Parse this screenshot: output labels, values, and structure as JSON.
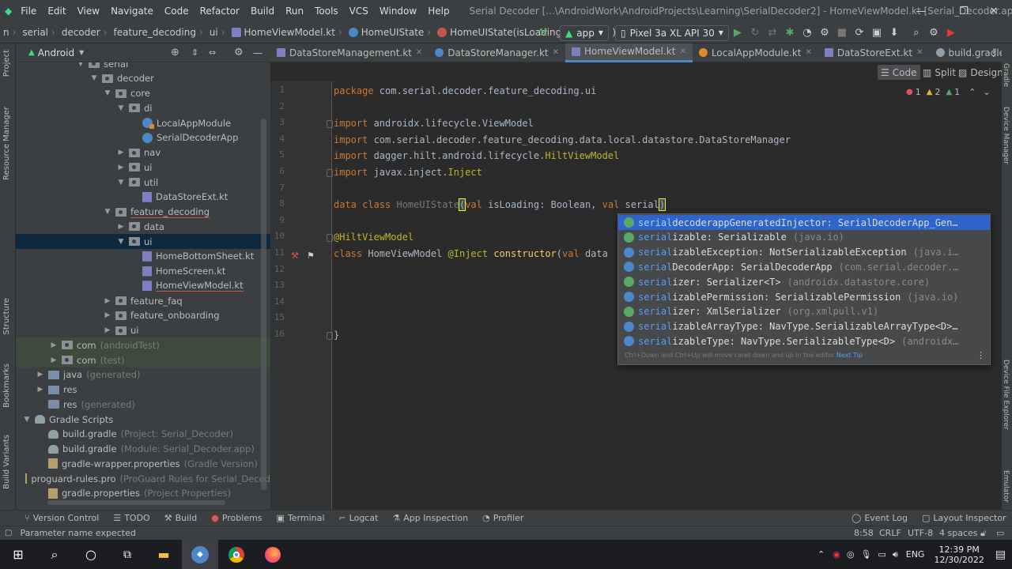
{
  "window": {
    "title": "Serial Decoder [...\\AndroidWork\\AndroidProjects\\Learning\\SerialDecoder2] - HomeViewModel.kt [Serial_Decoder.app.main]",
    "menu": [
      "File",
      "Edit",
      "View",
      "Navigate",
      "Code",
      "Refactor",
      "Build",
      "Run",
      "Tools",
      "VCS",
      "Window",
      "Help"
    ]
  },
  "navbar": {
    "crumbs": [
      "n",
      "serial",
      "decoder",
      "feature_decoding",
      "ui",
      "HomeViewModel.kt",
      "HomeUIState",
      "HomeUIState(isLoading: Boolean, )"
    ],
    "run_config": "app",
    "device": "Pixel 3a XL API 30"
  },
  "left_strip": {
    "tabs": [
      "Project",
      "Resource Manager",
      "Structure",
      "Bookmarks",
      "Build Variants"
    ]
  },
  "project_panel": {
    "view_mode": "Android",
    "tree": [
      {
        "label": "serial",
        "type": "pkg",
        "arrow": "v",
        "depth": 4
      },
      {
        "label": "decoder",
        "type": "pkg",
        "arrow": "v",
        "depth": 5
      },
      {
        "label": "core",
        "type": "pkg",
        "arrow": "v",
        "depth": 6
      },
      {
        "label": "di",
        "type": "pkg",
        "arrow": "v",
        "depth": 7
      },
      {
        "label": "LocalAppModule",
        "type": "ktg",
        "depth": 8
      },
      {
        "label": "SerialDecoderApp",
        "type": "kt",
        "depth": 8
      },
      {
        "label": "nav",
        "type": "pkg",
        "arrow": ">",
        "depth": 7
      },
      {
        "label": "ui",
        "type": "pkg",
        "arrow": ">",
        "depth": 7
      },
      {
        "label": "util",
        "type": "pkg",
        "arrow": "v",
        "depth": 7
      },
      {
        "label": "DataStoreExt.kt",
        "type": "ktf",
        "depth": 8
      },
      {
        "label": "feature_decoding",
        "type": "pkg",
        "arrow": "v",
        "depth": 6,
        "red": true
      },
      {
        "label": "data",
        "type": "pkg",
        "arrow": ">",
        "depth": 7
      },
      {
        "label": "ui",
        "type": "pkg",
        "arrow": "v",
        "depth": 7,
        "selected": true
      },
      {
        "label": "HomeBottomSheet.kt",
        "type": "ktf",
        "depth": 8
      },
      {
        "label": "HomeScreen.kt",
        "type": "ktf",
        "depth": 8
      },
      {
        "label": "HomeViewModel.kt",
        "type": "ktf",
        "depth": 8,
        "red": true
      },
      {
        "label": "feature_faq",
        "type": "pkg",
        "arrow": ">",
        "depth": 6
      },
      {
        "label": "feature_onboarding",
        "type": "pkg",
        "arrow": ">",
        "depth": 6
      },
      {
        "label": "ui",
        "type": "pkg",
        "arrow": ">",
        "depth": 6
      },
      {
        "label": "com",
        "hint": "(androidTest)",
        "type": "pkg",
        "arrow": ">",
        "depth": 2,
        "green": true
      },
      {
        "label": "com",
        "hint": "(test)",
        "type": "pkg",
        "arrow": ">",
        "depth": 2,
        "green": true
      },
      {
        "label": "java",
        "hint": "(generated)",
        "type": "folder",
        "arrow": ">",
        "depth": 1
      },
      {
        "label": "res",
        "type": "folder",
        "arrow": ">",
        "depth": 1
      },
      {
        "label": "res",
        "hint": "(generated)",
        "type": "folder",
        "depth": 1
      },
      {
        "label": "Gradle Scripts",
        "type": "gradle",
        "arrow": "v",
        "depth": 0
      },
      {
        "label": "build.gradle",
        "hint": "(Project: Serial_Decoder)",
        "type": "gradle",
        "depth": 1
      },
      {
        "label": "build.gradle",
        "hint": "(Module: Serial_Decoder.app)",
        "type": "gradle",
        "depth": 1
      },
      {
        "label": "gradle-wrapper.properties",
        "hint": "(Gradle Version)",
        "type": "props",
        "depth": 1
      },
      {
        "label": "proguard-rules.pro",
        "hint": "(ProGuard Rules for Serial_Decod",
        "type": "props",
        "depth": 1
      },
      {
        "label": "gradle.properties",
        "hint": "(Project Properties)",
        "type": "props",
        "depth": 1
      }
    ]
  },
  "tabs": [
    {
      "label": "DataStoreManagement.kt",
      "icon": "ktf"
    },
    {
      "label": "DataStoreManager.kt",
      "icon": "kt"
    },
    {
      "label": "HomeViewModel.kt",
      "icon": "ktf",
      "active": true
    },
    {
      "label": "LocalAppModule.kt",
      "icon": "ktg"
    },
    {
      "label": "DataStoreExt.kt",
      "icon": "ktf"
    },
    {
      "label": "build.gradle (:app)",
      "icon": "gradle"
    }
  ],
  "view_modes": {
    "code": "Code",
    "split": "Split",
    "design": "Design"
  },
  "inspection": {
    "errors": "1",
    "warnings": "2",
    "weak": "1"
  },
  "code_lines": [
    [
      [
        "kw",
        "package "
      ],
      [
        "cls",
        "com.serial.decoder.feature_decoding.ui"
      ]
    ],
    [],
    [
      [
        "kw",
        "import "
      ],
      [
        "cls",
        "androidx.lifecycle.ViewModel"
      ]
    ],
    [
      [
        "kw",
        "import "
      ],
      [
        "cls",
        "com.serial.decoder.feature_decoding.data.local.datastore.DataStoreManager"
      ]
    ],
    [
      [
        "kw",
        "import "
      ],
      [
        "cls",
        "dagger.hilt.android.lifecycle."
      ],
      [
        "ann",
        "HiltViewModel"
      ]
    ],
    [
      [
        "kw",
        "import "
      ],
      [
        "cls",
        "javax.inject."
      ],
      [
        "ann",
        "Inject"
      ]
    ],
    [],
    [
      [
        "kw",
        "data class "
      ],
      [
        "dim",
        "HomeUIState"
      ],
      [
        "caretp",
        "("
      ],
      [
        "kw",
        "val "
      ],
      [
        "param",
        "isLoading"
      ],
      [
        "cls",
        ": Boolean, "
      ],
      [
        "kw",
        "val "
      ],
      [
        "param",
        "serial"
      ],
      [
        "caretp",
        ")"
      ]
    ],
    [],
    [
      [
        "ann",
        "@HiltViewModel"
      ]
    ],
    [
      [
        "kw",
        "class "
      ],
      [
        "cls",
        "HomeViewModel "
      ],
      [
        "ann",
        "@Inject "
      ],
      [
        "fn",
        "constructor"
      ],
      [
        "cls",
        "("
      ],
      [
        "kw",
        "val "
      ],
      [
        "param",
        "data"
      ]
    ],
    [],
    [],
    [],
    [],
    [
      [
        "cls",
        "}"
      ]
    ]
  ],
  "autocomplete": {
    "items": [
      {
        "match": "serial",
        "rest": "decoderappGeneratedInjector",
        "type": ": SerialDecoderApp_Gen…",
        "pkg": "",
        "icon": "#59a869"
      },
      {
        "match": "serial",
        "rest": "izable",
        "type": ": Serializable",
        "pkg": "(java.io)",
        "icon": "#59a869"
      },
      {
        "match": "serial",
        "rest": "izableException",
        "type": ": NotSerializableException",
        "pkg": "(java.i…",
        "icon": "#4a88c7"
      },
      {
        "match": "serial",
        "rest": "DecoderApp",
        "type": ": SerialDecoderApp",
        "pkg": "(com.serial.decoder.…",
        "icon": "#4a88c7"
      },
      {
        "match": "serial",
        "rest": "izer",
        "type": ": Serializer<T>",
        "pkg": "(androidx.datastore.core)",
        "icon": "#59a869"
      },
      {
        "match": "serial",
        "rest": "izablePermission",
        "type": ": SerializablePermission",
        "pkg": "(java.io)",
        "icon": "#4a88c7"
      },
      {
        "match": "serial",
        "rest": "izer",
        "type": ": XmlSerializer",
        "pkg": "(org.xmlpull.v1)",
        "icon": "#59a869"
      },
      {
        "match": "serial",
        "rest": "izableArrayType",
        "type": ": NavType.SerializableArrayType<D>…",
        "pkg": "",
        "icon": "#4a88c7"
      },
      {
        "match": "serial",
        "rest": "izableType",
        "type": ": NavType.SerializableType<D>",
        "pkg": "(androidx…",
        "icon": "#4a88c7"
      }
    ],
    "footer_text": "Ctrl+Down and Ctrl+Up will move caret down and up in the editor",
    "footer_link": "Next Tip"
  },
  "right_strip": {
    "tabs": [
      "Gradle",
      "Device Manager",
      "Device File Explorer",
      "Emulator"
    ]
  },
  "bottom_tools": [
    "Version Control",
    "TODO",
    "Build",
    "Problems",
    "Terminal",
    "Logcat",
    "App Inspection",
    "Profiler"
  ],
  "bottom_right_tools": [
    "Event Log",
    "Layout Inspector"
  ],
  "status": {
    "message": "Parameter name expected",
    "position": "8:58",
    "line_sep": "CRLF",
    "encoding": "UTF-8",
    "indent": "4 spaces"
  },
  "taskbar": {
    "time": "12:39 PM",
    "date": "12/30/2022",
    "lang": "ENG"
  }
}
